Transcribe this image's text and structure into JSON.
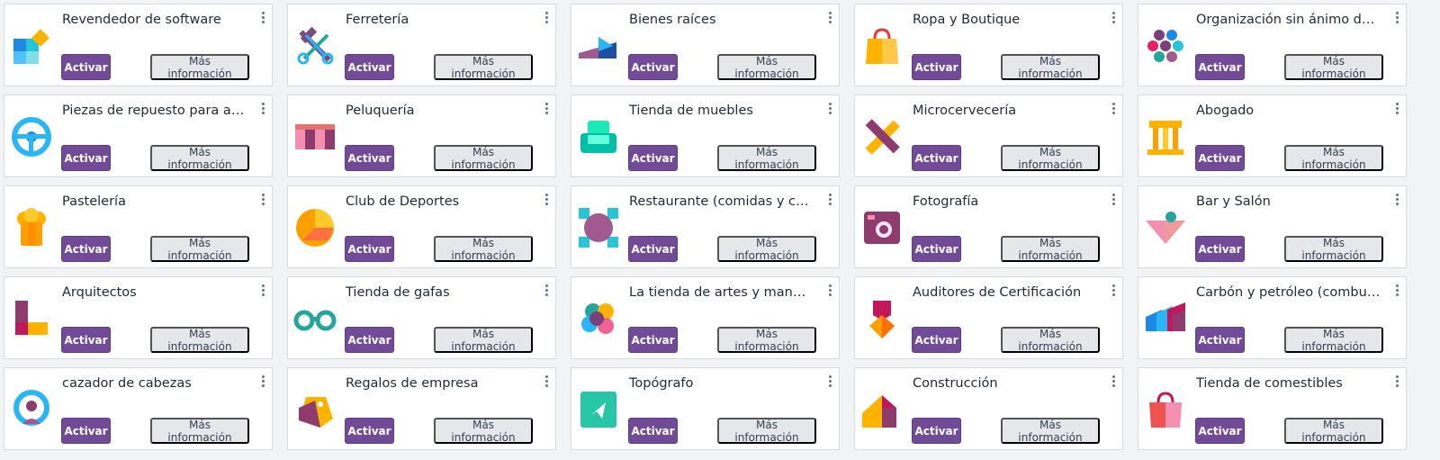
{
  "labels": {
    "activate": "Activar",
    "more_info": "Más información"
  },
  "apps": [
    {
      "title": "Revendedor de software",
      "icon": "software-reseller-icon"
    },
    {
      "title": "Ferretería",
      "icon": "hardware-store-icon"
    },
    {
      "title": "Bienes raíces",
      "icon": "real-estate-icon"
    },
    {
      "title": "Ropa y Boutique",
      "icon": "clothing-boutique-icon"
    },
    {
      "title": "Organización sin ánimo de lucro",
      "icon": "nonprofit-icon"
    },
    {
      "title": "Piezas de repuesto para automóviles",
      "icon": "car-parts-icon"
    },
    {
      "title": "Peluquería",
      "icon": "hair-salon-icon"
    },
    {
      "title": "Tienda de muebles",
      "icon": "furniture-store-icon"
    },
    {
      "title": "Microcervecería",
      "icon": "microbrewery-icon"
    },
    {
      "title": "Abogado",
      "icon": "lawyer-icon"
    },
    {
      "title": "Pastelería",
      "icon": "bakery-icon"
    },
    {
      "title": "Club de Deportes",
      "icon": "sports-club-icon"
    },
    {
      "title": "Restaurante (comidas y cafetería)",
      "icon": "restaurant-icon"
    },
    {
      "title": "Fotografía",
      "icon": "photography-icon"
    },
    {
      "title": "Bar y Salón",
      "icon": "bar-lounge-icon"
    },
    {
      "title": "Arquitectos",
      "icon": "architects-icon"
    },
    {
      "title": "Tienda de gafas",
      "icon": "eyewear-store-icon"
    },
    {
      "title": "La tienda de artes y manualidades",
      "icon": "arts-crafts-icon"
    },
    {
      "title": "Auditores de Certificación",
      "icon": "certification-auditors-icon"
    },
    {
      "title": "Carbón y petróleo (combustibles)",
      "icon": "coal-oil-icon"
    },
    {
      "title": "cazador de cabezas",
      "icon": "headhunter-icon"
    },
    {
      "title": "Regalos de empresa",
      "icon": "corporate-gifts-icon"
    },
    {
      "title": "Topógrafo",
      "icon": "surveyor-icon"
    },
    {
      "title": "Construcción",
      "icon": "construction-icon"
    },
    {
      "title": "Tienda de comestibles",
      "icon": "grocery-store-icon"
    }
  ]
}
